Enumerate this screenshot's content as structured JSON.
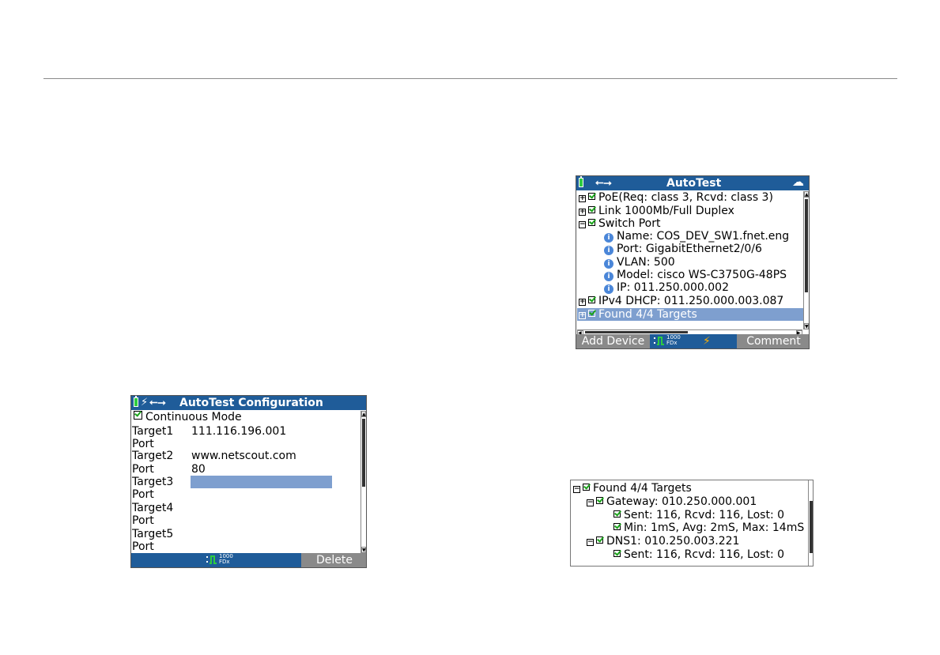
{
  "config_screen": {
    "title": "AutoTest Configuration",
    "continuous_mode": "Continuous Mode",
    "fields": [
      {
        "label": "Target1",
        "value": "111.116.196.001"
      },
      {
        "label": "Port",
        "value": ""
      },
      {
        "label": "Target2",
        "value": "www.netscout.com"
      },
      {
        "label": "Port",
        "value": "80"
      },
      {
        "label": "Target3",
        "value": ""
      },
      {
        "label": "Port",
        "value": ""
      },
      {
        "label": "Target4",
        "value": ""
      },
      {
        "label": "Port",
        "value": ""
      },
      {
        "label": "Target5",
        "value": ""
      },
      {
        "label": "Port",
        "value": ""
      }
    ],
    "link_speed": "1000",
    "link_duplex": "FDx",
    "delete_label": "Delete"
  },
  "autotest_screen": {
    "title": "AutoTest",
    "rows": [
      {
        "text": "PoE(Req: class 3, Rcvd: class 3)"
      },
      {
        "text": "Link 1000Mb/Full Duplex"
      },
      {
        "text": "Switch Port"
      },
      {
        "text": "Name: COS_DEV_SW1.fnet.eng"
      },
      {
        "text": "Port: GigabitEthernet2/0/6"
      },
      {
        "text": "VLAN: 500"
      },
      {
        "text": "Model: cisco WS-C3750G-48PS"
      },
      {
        "text": "IP:  011.250.000.002"
      },
      {
        "text": "IPv4 DHCP:  011.250.000.003.087"
      },
      {
        "text": "Found 4/4 Targets"
      }
    ],
    "add_device_label": "Add Device",
    "comment_label": "Comment",
    "link_speed": "1000",
    "link_duplex": "FDx"
  },
  "targets_screen": {
    "rows": [
      {
        "text": "Found 4/4 Targets"
      },
      {
        "text": "Gateway: 010.250.000.001"
      },
      {
        "text": "Sent: 116, Rcvd: 116, Lost: 0"
      },
      {
        "text": "Min: 1mS, Avg: 2mS, Max: 14mS"
      },
      {
        "text": "DNS1: 010.250.003.221"
      },
      {
        "text": "Sent: 116, Rcvd: 116, Lost: 0"
      }
    ]
  },
  "colors": {
    "titlebar": "#1f5c99",
    "selection": "#7e9fcf",
    "softkey": "#8a8a8a",
    "check": "#1aa31a"
  }
}
